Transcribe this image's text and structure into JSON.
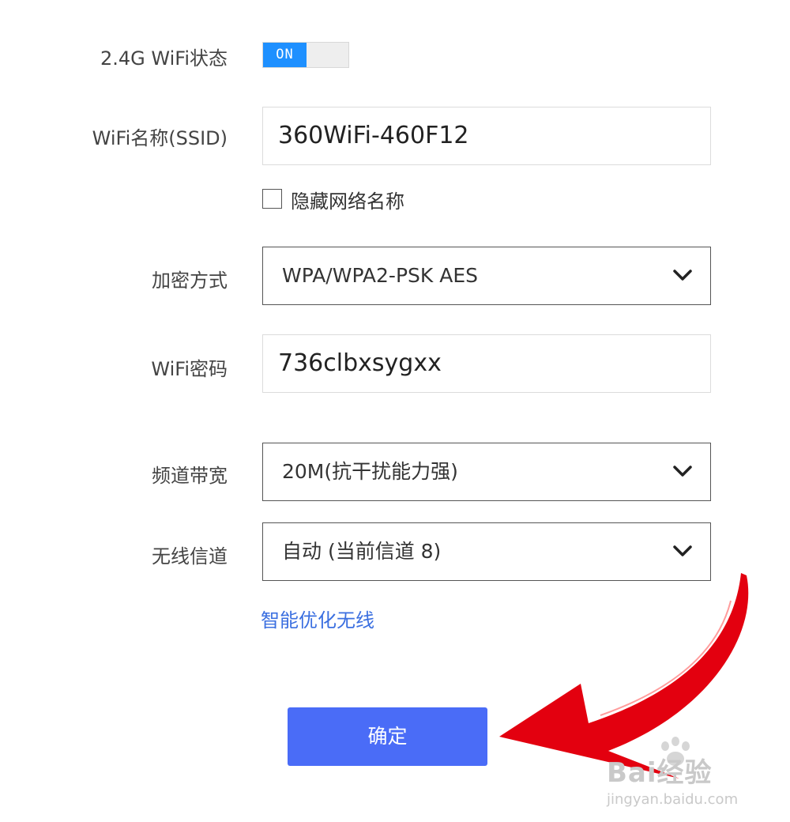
{
  "wifi_status": {
    "label": "2.4G WiFi状态",
    "toggle_text": "ON",
    "toggle_color": "#1e90ff"
  },
  "ssid": {
    "label": "WiFi名称(SSID)",
    "value": "360WiFi-460F12"
  },
  "hide_ssid": {
    "label": "隐藏网络名称",
    "checked": false
  },
  "encryption": {
    "label": "加密方式",
    "selected": "WPA/WPA2-PSK AES"
  },
  "password": {
    "label": "WiFi密码",
    "value": "736clbxsygxx"
  },
  "bandwidth": {
    "label": "频道带宽",
    "selected": "20M(抗干扰能力强)"
  },
  "channel": {
    "label": "无线信道",
    "selected": "自动 (当前信道 8)"
  },
  "optimize_link": {
    "text": "智能优化无线",
    "color": "#3b6fe0"
  },
  "confirm_button": {
    "label": "确定",
    "color": "#4a6cf7"
  },
  "annotation": {
    "arrow_color": "#e3000f"
  },
  "watermark": {
    "main": "Bai经验",
    "sub": "jingyan.baidu.com"
  },
  "icons": {
    "dropdown": "chevron-down-icon",
    "paw": "paw-icon",
    "arrow": "arrow-annotation"
  }
}
